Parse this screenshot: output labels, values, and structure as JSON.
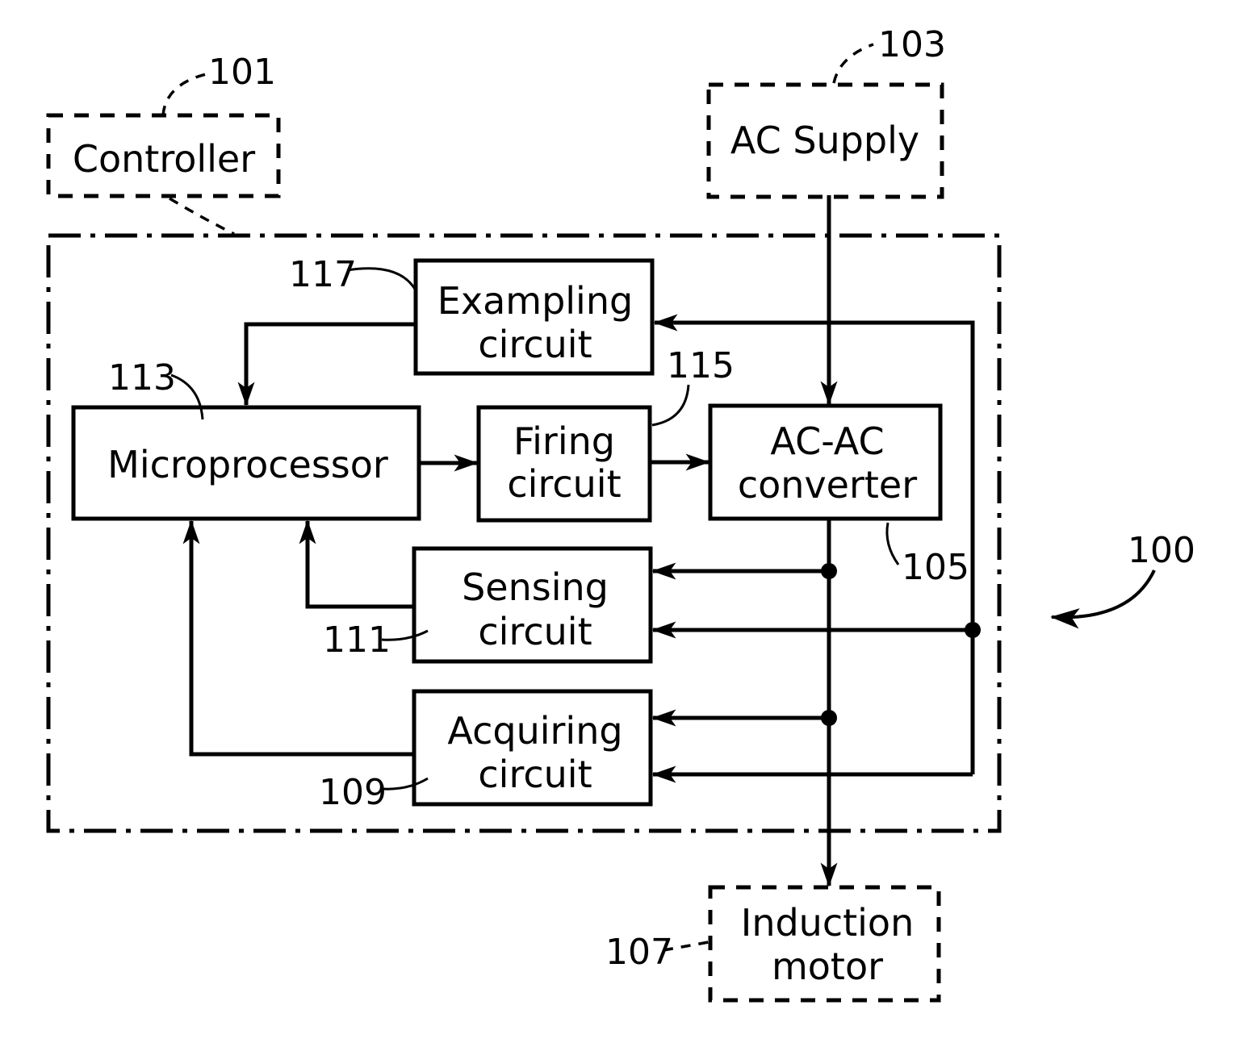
{
  "figure": {
    "system_ref": "100",
    "external_blocks": [
      {
        "id": "controller",
        "label_lines": [
          "Controller"
        ],
        "ref": "101",
        "style": "dashed"
      },
      {
        "id": "ac_supply",
        "label_lines": [
          "AC Supply"
        ],
        "ref": "103",
        "style": "dashed"
      },
      {
        "id": "induction_motor",
        "label_lines": [
          "Induction",
          "motor"
        ],
        "ref": "107",
        "style": "dashed"
      }
    ],
    "internal_blocks": [
      {
        "id": "exampling",
        "label_lines": [
          "Exampling",
          "circuit"
        ],
        "ref": "117"
      },
      {
        "id": "microprocessor",
        "label_lines": [
          "Microprocessor"
        ],
        "ref": "113"
      },
      {
        "id": "firing",
        "label_lines": [
          "Firing",
          "circuit"
        ],
        "ref": "115"
      },
      {
        "id": "converter",
        "label_lines": [
          "AC-AC",
          "converter"
        ],
        "ref": "105"
      },
      {
        "id": "sensing",
        "label_lines": [
          "Sensing",
          "circuit"
        ],
        "ref": "111"
      },
      {
        "id": "acquiring",
        "label_lines": [
          "Acquiring",
          "circuit"
        ],
        "ref": "109"
      }
    ],
    "connections": [
      {
        "from": "ac_supply",
        "to": "converter"
      },
      {
        "from": "exampling",
        "to": "microprocessor"
      },
      {
        "from": "microprocessor",
        "to": "firing"
      },
      {
        "from": "firing",
        "to": "converter"
      },
      {
        "from": "converter",
        "to": "induction_motor"
      },
      {
        "from": "converter_output",
        "to": "sensing"
      },
      {
        "from": "converter_output",
        "to": "acquiring"
      },
      {
        "from": "supply_bus",
        "to": "exampling"
      },
      {
        "from": "supply_bus",
        "to": "sensing"
      },
      {
        "from": "supply_bus",
        "to": "acquiring"
      },
      {
        "from": "sensing",
        "to": "microprocessor"
      },
      {
        "from": "acquiring",
        "to": "microprocessor"
      }
    ]
  }
}
